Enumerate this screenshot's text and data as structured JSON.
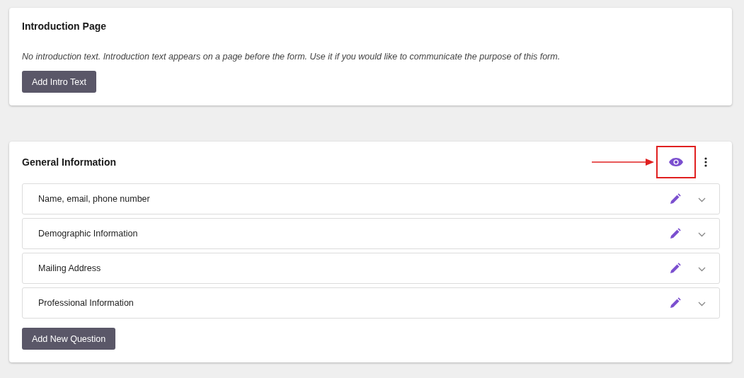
{
  "intro_card": {
    "title": "Introduction Page",
    "description": "No introduction text. Introduction text appears on a page before the form. Use it if you would like to communicate the purpose of this form.",
    "button": "Add Intro Text"
  },
  "section_card": {
    "title": "General Information",
    "highlight_preview": true,
    "questions": [
      {
        "label": "Name, email, phone number"
      },
      {
        "label": "Demographic Information"
      },
      {
        "label": "Mailing Address"
      },
      {
        "label": "Professional Information"
      }
    ],
    "button": "Add New Question"
  }
}
